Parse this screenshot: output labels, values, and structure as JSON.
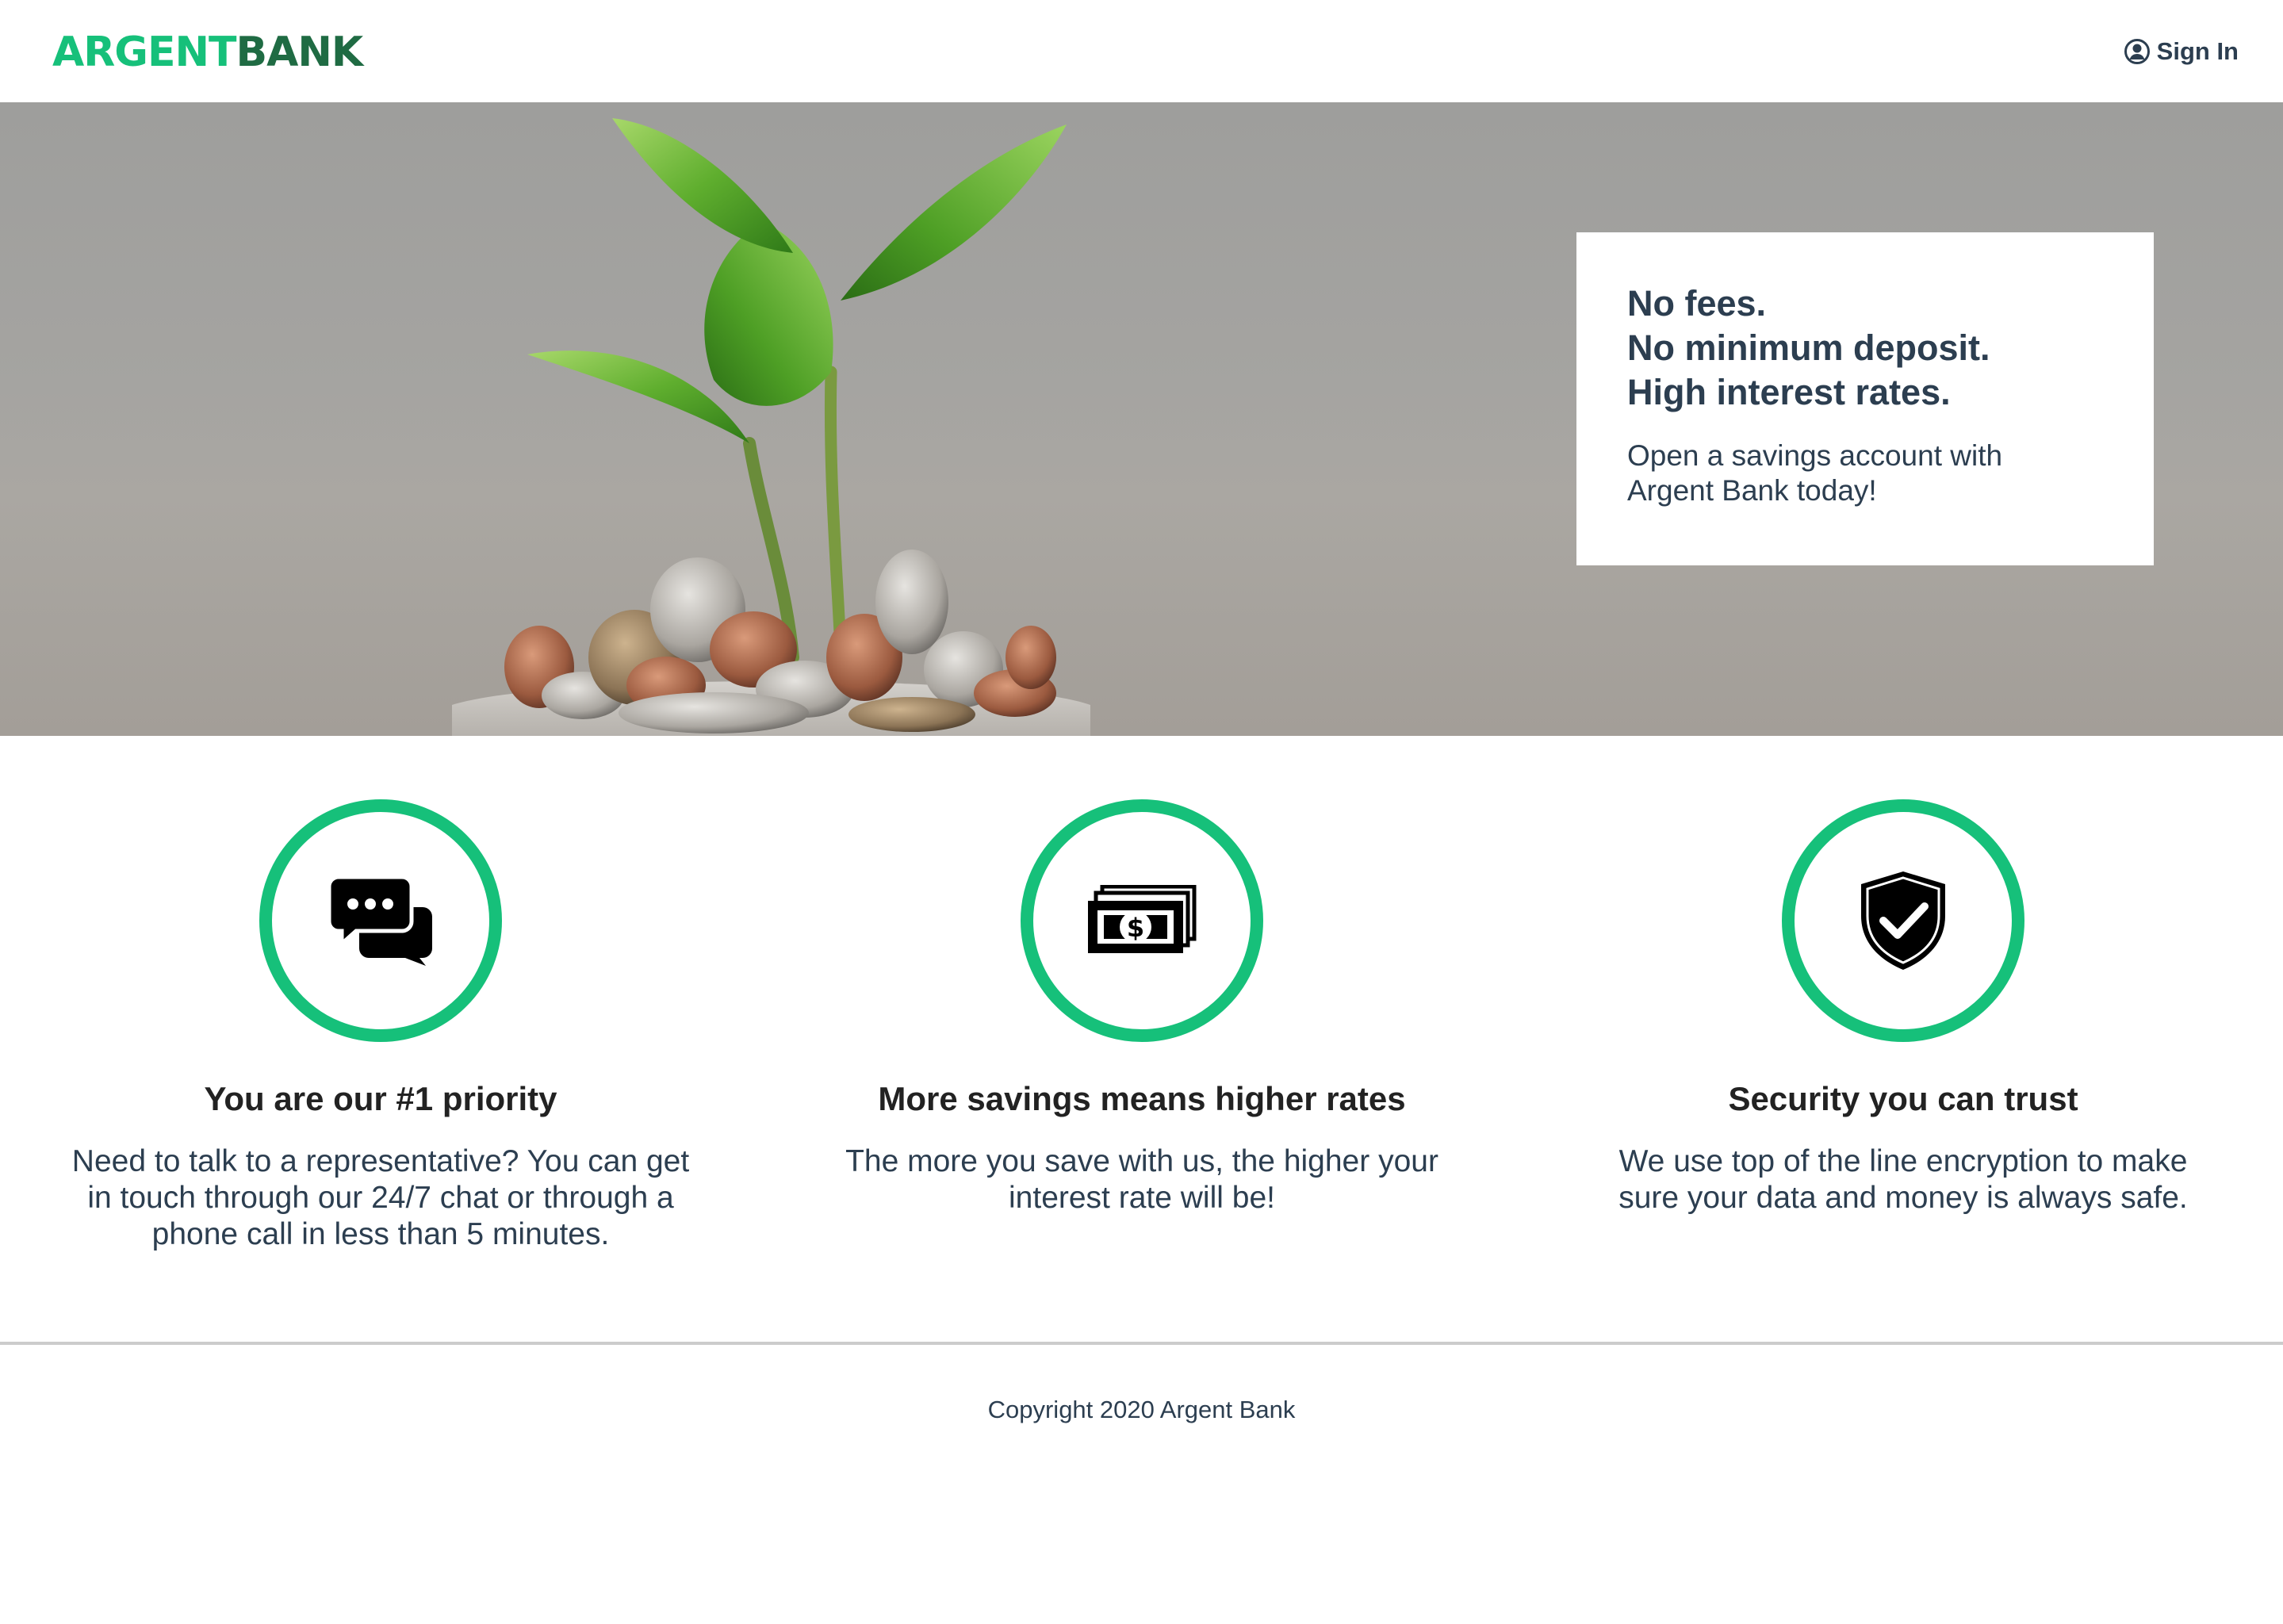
{
  "header": {
    "logo_part1": "ARGENT",
    "logo_part2": "BANK",
    "signin_label": "Sign In",
    "signin_icon": "user-circle-icon"
  },
  "hero": {
    "image": "plant-growing-from-coins-in-jar",
    "promo": {
      "line1": "No fees.",
      "line2": "No minimum deposit.",
      "line3": "High interest rates.",
      "subtitle": "Open a savings account with Argent Bank today!"
    }
  },
  "features": [
    {
      "icon": "chat-icon",
      "title": "You are our #1 priority",
      "text": "Need to talk to a representative? You can get in touch through our 24/7 chat or through a phone call in less than 5 minutes."
    },
    {
      "icon": "money-icon",
      "title": "More savings means higher rates",
      "text": "The more you save with us, the higher your interest rate will be!"
    },
    {
      "icon": "security-shield-icon",
      "title": "Security you can trust",
      "text": "We use top of the line encryption to make sure your data and money is always safe."
    }
  ],
  "footer": {
    "copyright": "Copyright 2020 Argent Bank"
  },
  "colors": {
    "accent_green": "#16c07a",
    "logo_dark_green": "#1f6b43",
    "text_dark": "#2c3e50"
  }
}
